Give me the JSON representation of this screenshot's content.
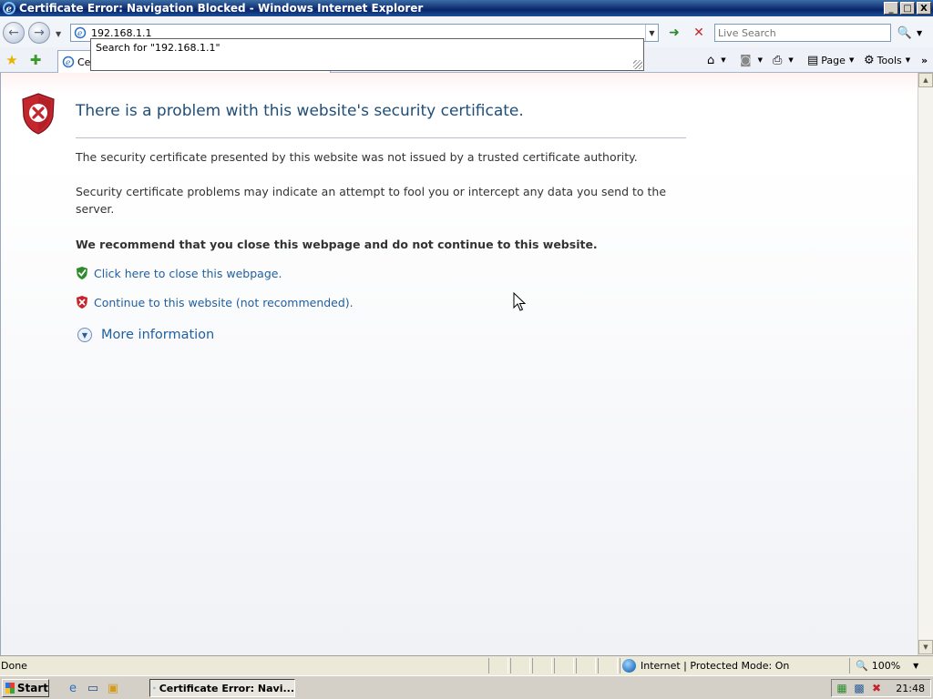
{
  "window": {
    "title": "Certificate Error: Navigation Blocked - Windows Internet Explorer",
    "controls": {
      "minimize": "_",
      "maximize": "□",
      "close": "X"
    }
  },
  "address_bar": {
    "url": "192.168.1.1",
    "autocomplete": "Search for \"192.168.1.1\""
  },
  "search": {
    "placeholder": "Live Search"
  },
  "tab": {
    "label": "Cer"
  },
  "command_bar": {
    "page_label": "Page",
    "tools_label": "Tools"
  },
  "error_page": {
    "title": "There is a problem with this website's security certificate.",
    "para1": "The security certificate presented by this website was not issued by a trusted certificate authority.",
    "para2": "Security certificate problems may indicate an attempt to fool you or intercept any data you send to the server.",
    "recommendation": "We recommend that you close this webpage and do not continue to this website.",
    "close_link": "Click here to close this webpage.",
    "continue_link": "Continue to this website (not recommended).",
    "more_info": "More information"
  },
  "status_bar": {
    "status": "Done",
    "zone": "Internet | Protected Mode: On",
    "zoom": "100%"
  },
  "taskbar": {
    "start_label": "Start",
    "task_button": "Certificate Error: Navi...",
    "clock": "21:48"
  },
  "colors": {
    "title_bar": "#0a246a",
    "link": "#1f5f9e",
    "heading": "#1f4e79",
    "error_red": "#c4262e",
    "ok_green": "#2e8b2e"
  }
}
